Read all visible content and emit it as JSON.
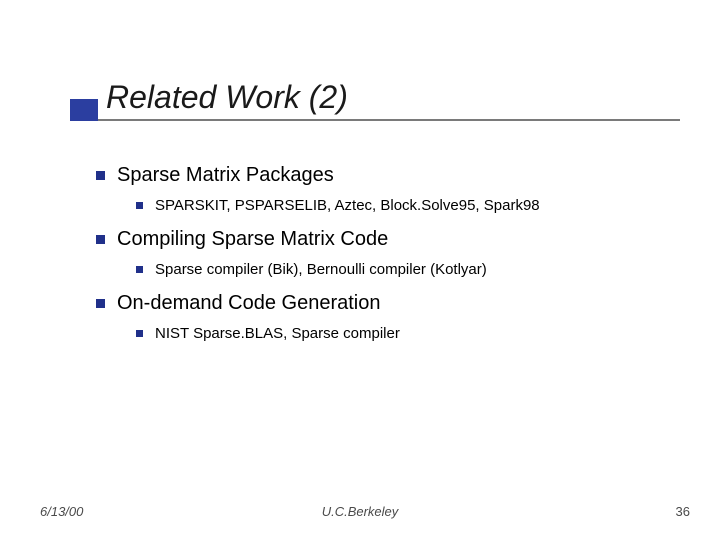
{
  "title": "Related Work (2)",
  "bullets": [
    {
      "text": "Sparse Matrix Packages",
      "sub": [
        {
          "text": "SPARSKIT, PSPARSELIB, Aztec, Block.Solve95, Spark98"
        }
      ]
    },
    {
      "text": "Compiling Sparse Matrix Code",
      "sub": [
        {
          "text": "Sparse compiler (Bik),  Bernoulli compiler (Kotlyar)"
        }
      ]
    },
    {
      "text": "On-demand Code Generation",
      "sub": [
        {
          "text": "NIST Sparse.BLAS, Sparse compiler"
        }
      ]
    }
  ],
  "footer": {
    "date": "6/13/00",
    "org": "U.C.Berkeley",
    "page": "36"
  }
}
